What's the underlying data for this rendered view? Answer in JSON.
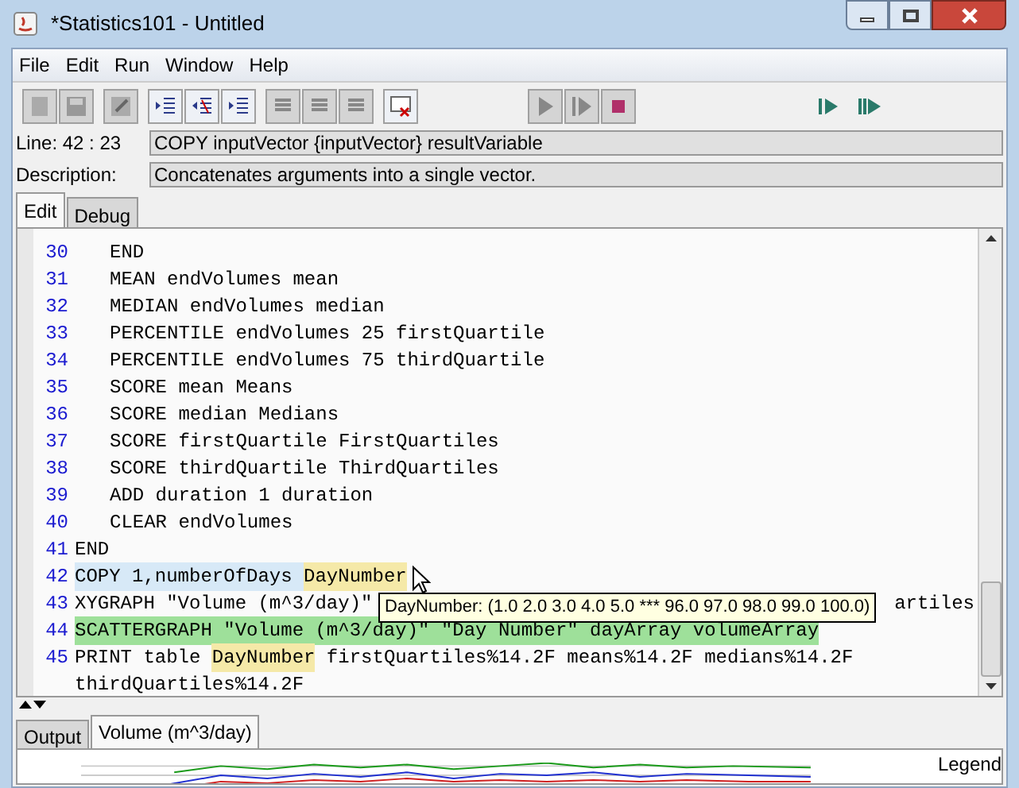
{
  "window": {
    "title": "*Statistics101 - Untitled"
  },
  "menu": [
    "File",
    "Edit",
    "Run",
    "Window",
    "Help"
  ],
  "info": {
    "line_label": "Line: 42 : 23",
    "line_value": "COPY inputVector {inputVector} resultVariable",
    "description_label": "Description:",
    "description_value": "Concatenates arguments into a single vector."
  },
  "editor_tabs": [
    {
      "label": "Edit",
      "selected": true
    },
    {
      "label": "Debug",
      "selected": false
    }
  ],
  "code_lines": [
    {
      "number": "30",
      "indent": true,
      "segments": [
        {
          "text": "END",
          "highlight": false
        }
      ]
    },
    {
      "number": "31",
      "indent": true,
      "segments": [
        {
          "text": "MEAN endVolumes mean",
          "highlight": false
        }
      ]
    },
    {
      "number": "32",
      "indent": true,
      "segments": [
        {
          "text": "MEDIAN endVolumes median",
          "highlight": false
        }
      ]
    },
    {
      "number": "33",
      "indent": true,
      "segments": [
        {
          "text": "PERCENTILE endVolumes 25 firstQuartile",
          "highlight": false
        }
      ]
    },
    {
      "number": "34",
      "indent": true,
      "segments": [
        {
          "text": "PERCENTILE endVolumes 75 thirdQuartile",
          "highlight": false
        }
      ]
    },
    {
      "number": "35",
      "indent": true,
      "segments": [
        {
          "text": "SCORE mean Means",
          "highlight": false
        }
      ]
    },
    {
      "number": "36",
      "indent": true,
      "segments": [
        {
          "text": "SCORE median Medians",
          "highlight": false
        }
      ]
    },
    {
      "number": "37",
      "indent": true,
      "segments": [
        {
          "text": "SCORE firstQuartile FirstQuartiles",
          "highlight": false
        }
      ]
    },
    {
      "number": "38",
      "indent": true,
      "segments": [
        {
          "text": "SCORE thirdQuartile ThirdQuartiles",
          "highlight": false
        }
      ]
    },
    {
      "number": "39",
      "indent": true,
      "segments": [
        {
          "text": "ADD duration 1 duration",
          "highlight": false
        }
      ]
    },
    {
      "number": "40",
      "indent": true,
      "segments": [
        {
          "text": "CLEAR endVolumes",
          "highlight": false
        }
      ]
    },
    {
      "number": "41",
      "indent": false,
      "segments": [
        {
          "text": "END",
          "highlight": false
        }
      ]
    },
    {
      "number": "42",
      "indent": false,
      "color": "#d7e9f7",
      "segments": [
        {
          "text": "COPY 1,numberOfDays ",
          "highlight": false
        },
        {
          "text": "DayNumber",
          "highlight": true
        }
      ]
    },
    {
      "number": "43",
      "indent": false,
      "tail": "artiles",
      "segments": [
        {
          "text": "XYGRAPH \"Volume (m^3/day)\"",
          "highlight": false
        }
      ]
    },
    {
      "number": "44",
      "indent": false,
      "color": "#9ee09a",
      "segments": [
        {
          "text": "SCATTERGRAPH \"Volume (m^3/day)\" \"Day Number\" dayArray volumeArray",
          "highlight": false
        }
      ]
    },
    {
      "number": "45",
      "indent": false,
      "segments": [
        {
          "text": "PRINT table ",
          "highlight": false
        },
        {
          "text": "DayNumber",
          "highlight": true
        },
        {
          "text": " firstQuartiles%14.2F means%14.2F medians%14.2F",
          "highlight": false
        }
      ]
    },
    {
      "indent": false,
      "segments": [
        {
          "text": "thirdQuartiles%14.2F",
          "highlight": false
        }
      ]
    }
  ],
  "tooltip": "DayNumber: (1.0 2.0 3.0 4.0 5.0 *** 96.0 97.0 98.0 99.0 100.0)",
  "output_tabs": [
    {
      "label": "Output",
      "selected": false
    },
    {
      "label": "Volume (m^3/day)",
      "selected": true
    }
  ],
  "chart": {
    "legend_title": "Legend"
  }
}
